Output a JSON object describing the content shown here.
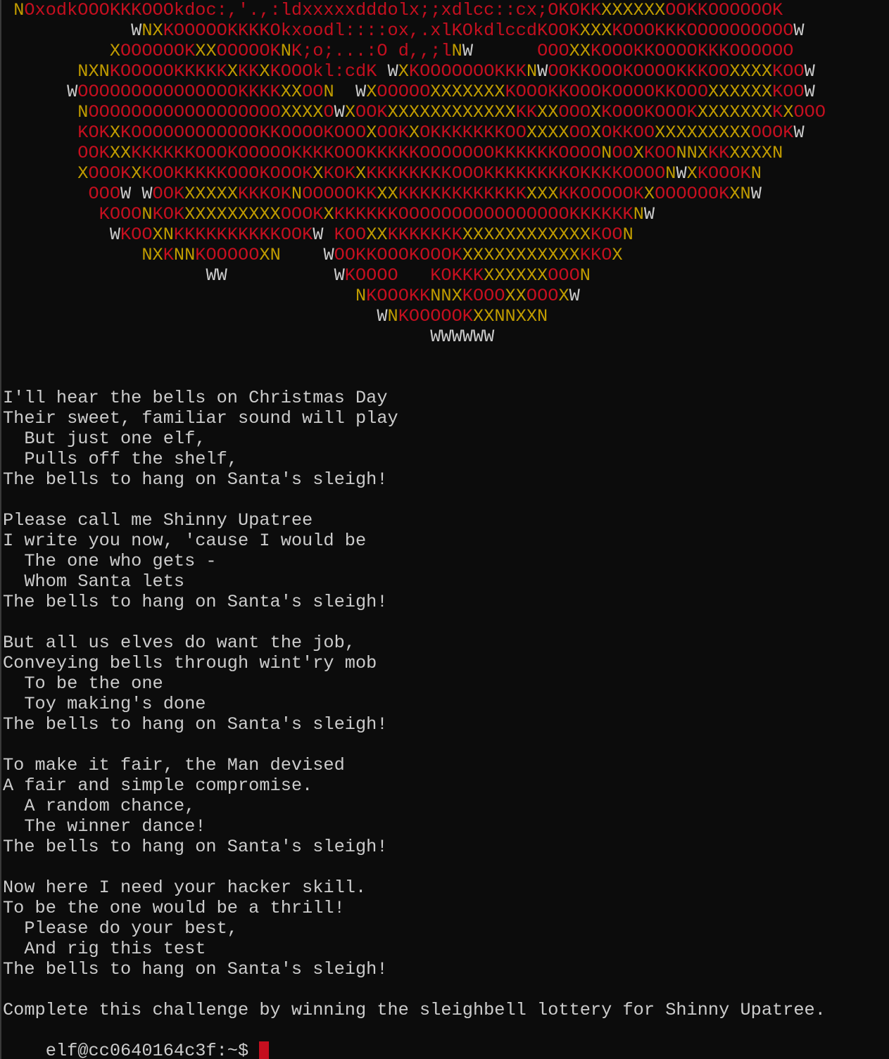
{
  "colors": {
    "background": "#0c0c0c",
    "text": "#cccccc",
    "art_red": "#c50f1f",
    "art_yellow": "#c19c00",
    "cursor": "#c50f1f"
  },
  "art": [
    " NOxodkOOOKKKOOOkdoc:,'.,:ldxxxxxdddolx;;xdlcc::cx;OKOKKXXXXXXOOKKOOOOOOK",
    "            WNXKOOOOOKKKKOkxoodl::::ox,.xlKOkdlccdKOOKXXXKOOOKKKOOOOOOOOOOW",
    "          XOOOOOOKXXOOOOOKNK;o;...:O d,,;lNW      OOOXXKOOOKKOOOOKKKOOOOOO",
    "       NXNKOOOOOKKKKKXKKXKOOOkl:cdK WXKOOOOOOOKKKNWOOKKOOOKOOOOKKKOOXXXXKOOW",
    "      WOOOOOOOOOOOOOOOKKKKXXOON  WXOOOOOXXXXXXXKOOOKKOOOKOOOOKKOOOXXXXXXKOOW",
    "       NOOOOOOOOOOOOOOOOOOXXXXOWXOOKXXXXXXXXXXXXKKXXOOOXKOOOKOOOKXXXXXXXKXOOO",
    "       KOKXKOOOOOOOOOOOOKKOOOOKOOOXOOKXOKKKKKKKOOXXXXOOXOKKOOXXXXXXXXXOOOKW",
    "       OOKXXKKKKKKOOOKOOOOOKKKKOOOKKKKKOOOOOOOKKKKKKOOOONOOXKOONNXKKXXXXN",
    "       XOOOKXKOOKKKKKOOOKOOOKXKOKXKKKKKKKKOOOKKKKKKKKOKKKKOOOONWXKOOOKN",
    "        OOOW WOOKXXXXXKKKOKNOOOOOKKXXKKKKKKKKKKKKXXXKKOOOOOKXOOOOOOKXNW",
    "         KOOONKOKXXXXXXXXXOOOKXKKKKKKOOOOOOOOOOOOOOOOKKKKKKNW",
    "          WKOOXNKKKKKKKKKKOOKW KOOXXKKKKKKKXXXXXXXXXXXXKOON",
    "             NXKNNKOOOOOXN    WOOKKOOOKOOOKXXXXXXXXXXXKKOX",
    "                   WW          WKOOOO   KOKKKXXXXXXOOON",
    "                                 NKOOOKKNNXKOOOXXOOOXW",
    "                                   WNKOOOOOKXXNNXXN",
    "                                        WWWWWW"
  ],
  "poem": [
    "I'll hear the bells on Christmas Day",
    "Their sweet, familiar sound will play",
    "  But just one elf,",
    "  Pulls off the shelf,",
    "The bells to hang on Santa's sleigh!",
    "",
    "Please call me Shinny Upatree",
    "I write you now, 'cause I would be",
    "  The one who gets -",
    "  Whom Santa lets",
    "The bells to hang on Santa's sleigh!",
    "",
    "But all us elves do want the job,",
    "Conveying bells through wint'ry mob",
    "  To be the one",
    "  Toy making's done",
    "The bells to hang on Santa's sleigh!",
    "",
    "To make it fair, the Man devised",
    "A fair and simple compromise.",
    "  A random chance,",
    "  The winner dance!",
    "The bells to hang on Santa's sleigh!",
    "",
    "Now here I need your hacker skill.",
    "To be the one would be a thrill!",
    "  Please do your best,",
    "  And rig this test",
    "The bells to hang on Santa's sleigh!",
    "",
    "Complete this challenge by winning the sleighbell lottery for Shinny Upatree."
  ],
  "prompt": "elf@cc0640164c3f:~$ "
}
